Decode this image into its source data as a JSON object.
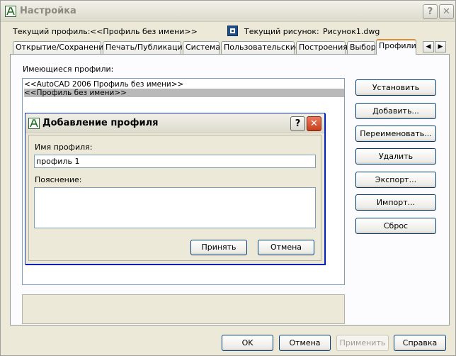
{
  "window": {
    "title": "Настройка",
    "help_glyph": "?",
    "close_glyph": "✕"
  },
  "header": {
    "profile_label": "Текущий профиль:",
    "profile_value": "<<Профиль без имени>>",
    "drawing_label": "Текущий рисунок:",
    "drawing_value": "Рисунок1.dwg"
  },
  "tabs": [
    {
      "label": "Открытие/Сохранение",
      "active": false
    },
    {
      "label": "Печать/Публикация",
      "active": false
    },
    {
      "label": "Система",
      "active": false
    },
    {
      "label": "Пользовательские",
      "active": false
    },
    {
      "label": "Построения",
      "active": false
    },
    {
      "label": "Выбор",
      "active": false
    },
    {
      "label": "Профили",
      "active": true
    }
  ],
  "tab_scroll": {
    "left": "◀",
    "right": "▶"
  },
  "profiles": {
    "list_label": "Имеющиеся профили:",
    "items": [
      {
        "label": "<<AutoCAD 2006 Профиль без имени>>",
        "selected": false
      },
      {
        "label": "<<Профиль без имени>>",
        "selected": true
      }
    ],
    "buttons": {
      "set": "Установить",
      "add": "Добавить...",
      "rename": "Переименовать...",
      "delete": "Удалить",
      "export": "Экспорт...",
      "import": "Импорт...",
      "reset": "Сброс"
    }
  },
  "dialog": {
    "title": "Добавление профиля",
    "help_glyph": "?",
    "close_glyph": "✕",
    "name_label": "Имя профиля:",
    "name_value": "профиль 1",
    "desc_label": "Пояснение:",
    "desc_value": "",
    "ok": "Принять",
    "cancel": "Отмена"
  },
  "footer": {
    "ok": "OK",
    "cancel": "Отмена",
    "apply": "Применить",
    "help": "Справка"
  },
  "colors": {
    "active_tab_accent": "#e68b2c",
    "selection": "#b9b9b9",
    "close_button": "#c7401c"
  }
}
